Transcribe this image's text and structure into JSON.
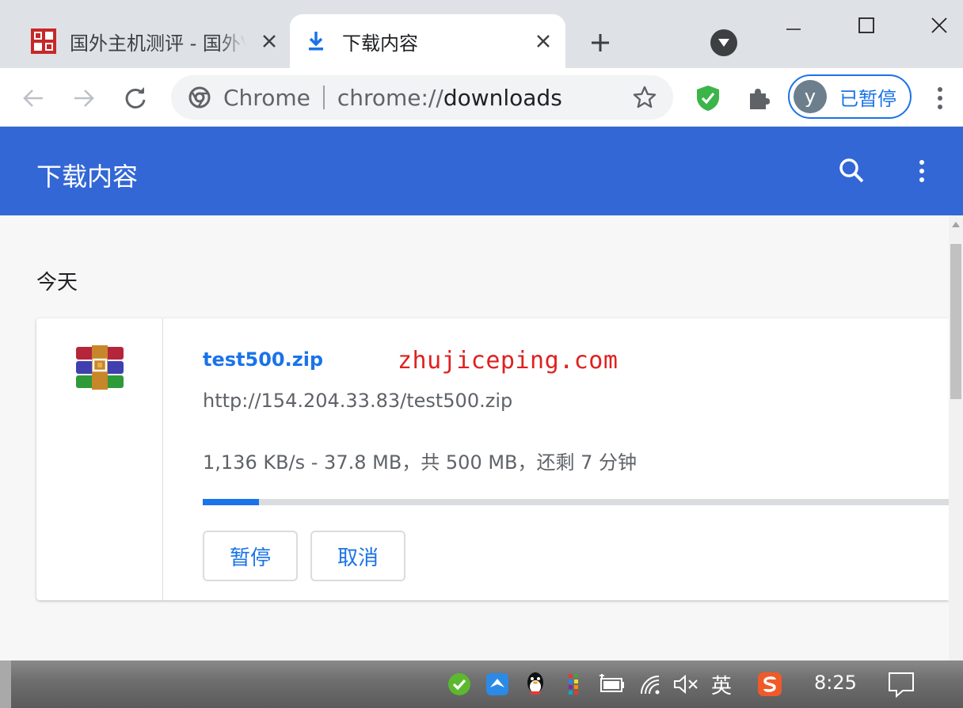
{
  "colors": {
    "accent": "#1a73e8",
    "header_bg": "#3367d6",
    "watermark": "#e02020"
  },
  "tabs": [
    {
      "title": "国外主机测评 - 国外VPS",
      "active": false,
      "favicon": "site-seal-icon"
    },
    {
      "title": "下载内容",
      "active": true,
      "favicon": "download-icon"
    }
  ],
  "toolbar": {
    "site_label": "Chrome",
    "url_scheme": "chrome://",
    "url_path": "downloads",
    "profile_initial": "y",
    "profile_status": "已暂停"
  },
  "downloads_page": {
    "title": "下载内容",
    "date_group": "今天",
    "item": {
      "file_name": "test500.zip",
      "watermark": "zhujiceping.com",
      "url": "http://154.204.33.83/test500.zip",
      "status": "1,136 KB/s - 37.8 MB，共 500 MB，还剩 7 分钟",
      "progress_percent": 7.56,
      "pause_label": "暂停",
      "cancel_label": "取消"
    }
  },
  "taskbar": {
    "ime_label": "英",
    "clock": "8:25"
  }
}
